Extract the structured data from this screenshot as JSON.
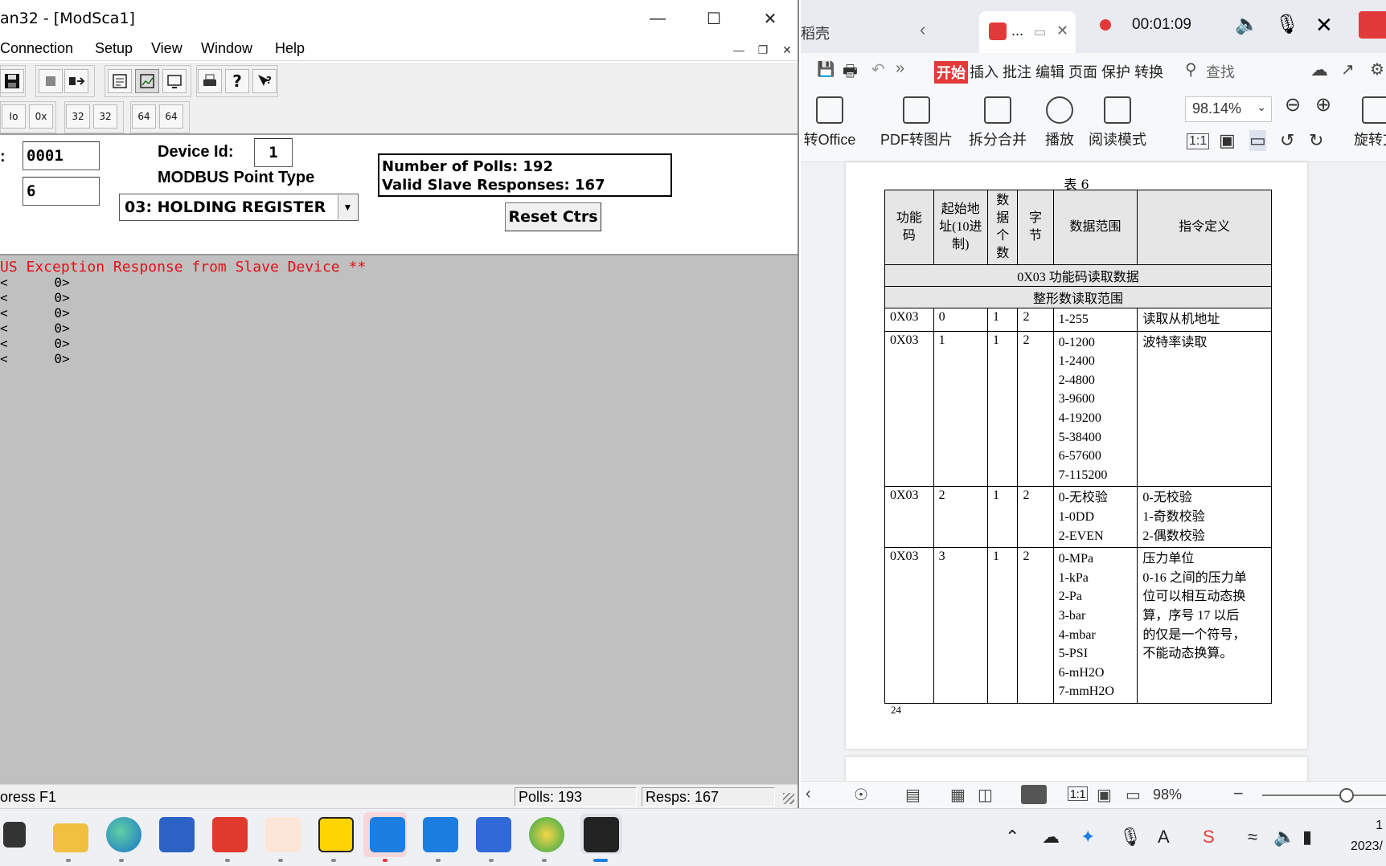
{
  "modscan": {
    "title": "an32 - [ModSca1]",
    "menu": [
      "Connection",
      "Setup",
      "View",
      "Window",
      "Help"
    ],
    "toolbar_row2": [
      "Io",
      "0x",
      "32",
      "32",
      "64",
      "64"
    ],
    "address_label": ":",
    "address_value": "0001",
    "length_value": "6",
    "device_id_label": "Device Id:",
    "device_id_value": "1",
    "point_type_label": "MODBUS Point Type",
    "point_type_value": "03: HOLDING REGISTER",
    "stats": {
      "polls": "Number of Polls: 192",
      "valid": "Valid Slave Responses: 167"
    },
    "reset_label": "Reset Ctrs",
    "exception_text": "US Exception Response from Slave Device **",
    "registers": [
      "<      0>",
      "<      0>",
      "<      0>",
      "<      0>",
      "<      0>",
      "<      0>"
    ],
    "status": {
      "help": "oress F1",
      "polls": "Polls: 193",
      "resps": "Resps: 167"
    }
  },
  "wps": {
    "tab1": "稻壳",
    "tab2": "...",
    "record_time": "00:01:09",
    "menu": [
      "开始",
      "插入",
      "批注",
      "编辑",
      "页面",
      "保护",
      "转换"
    ],
    "search_placeholder": "查找",
    "ribbon_buttons": [
      "转Office",
      "PDF转图片",
      "拆分合并",
      "播放",
      "阅读模式",
      "旋转文"
    ],
    "zoom": "98.14%",
    "table_caption": "表 6",
    "headers": [
      "功能码",
      "起始地址(10进制)",
      "数据个数",
      "字节",
      "数据范围",
      "指令定义"
    ],
    "section1": "0X03 功能码读取数据",
    "section2": "整形数读取范围",
    "rows": [
      {
        "code": "0X03",
        "addr": "0",
        "count": "1",
        "bytes": "2",
        "range": [
          "1-255"
        ],
        "def": [
          "读取从机地址"
        ]
      },
      {
        "code": "0X03",
        "addr": "1",
        "count": "1",
        "bytes": "2",
        "range": [
          "0-1200",
          "1-2400",
          "2-4800",
          "3-9600",
          "4-19200",
          "5-38400",
          "6-57600",
          "7-115200"
        ],
        "def": [
          "波特率读取"
        ]
      },
      {
        "code": "0X03",
        "addr": "2",
        "count": "1",
        "bytes": "2",
        "range": [
          "0-无校验",
          "1-0DD",
          "2-EVEN"
        ],
        "def": [
          "0-无校验",
          "1-奇数校验",
          "2-偶数校验"
        ]
      },
      {
        "code": "0X03",
        "addr": "3",
        "count": "1",
        "bytes": "2",
        "range": [
          "0-MPa",
          "1-kPa",
          "2-Pa",
          "3-bar",
          "4-mbar",
          "5-PSI",
          "6-mH2O",
          "7-mmH2O"
        ],
        "def": [
          "压力单位",
          "0-16 之间的压力单",
          "位可以相互动态换",
          "算，序号 17 以后",
          "的仅是一个符号，",
          "不能动态换算。"
        ]
      }
    ],
    "page_number": "24",
    "status_zoom": "98%"
  },
  "taskbar": {
    "clock_time": "1",
    "clock_date": "2023/"
  },
  "colors": {
    "exception_red": "#e0101a",
    "data_gray": "#c0c0c0",
    "wps_red": "#e23a3a"
  }
}
